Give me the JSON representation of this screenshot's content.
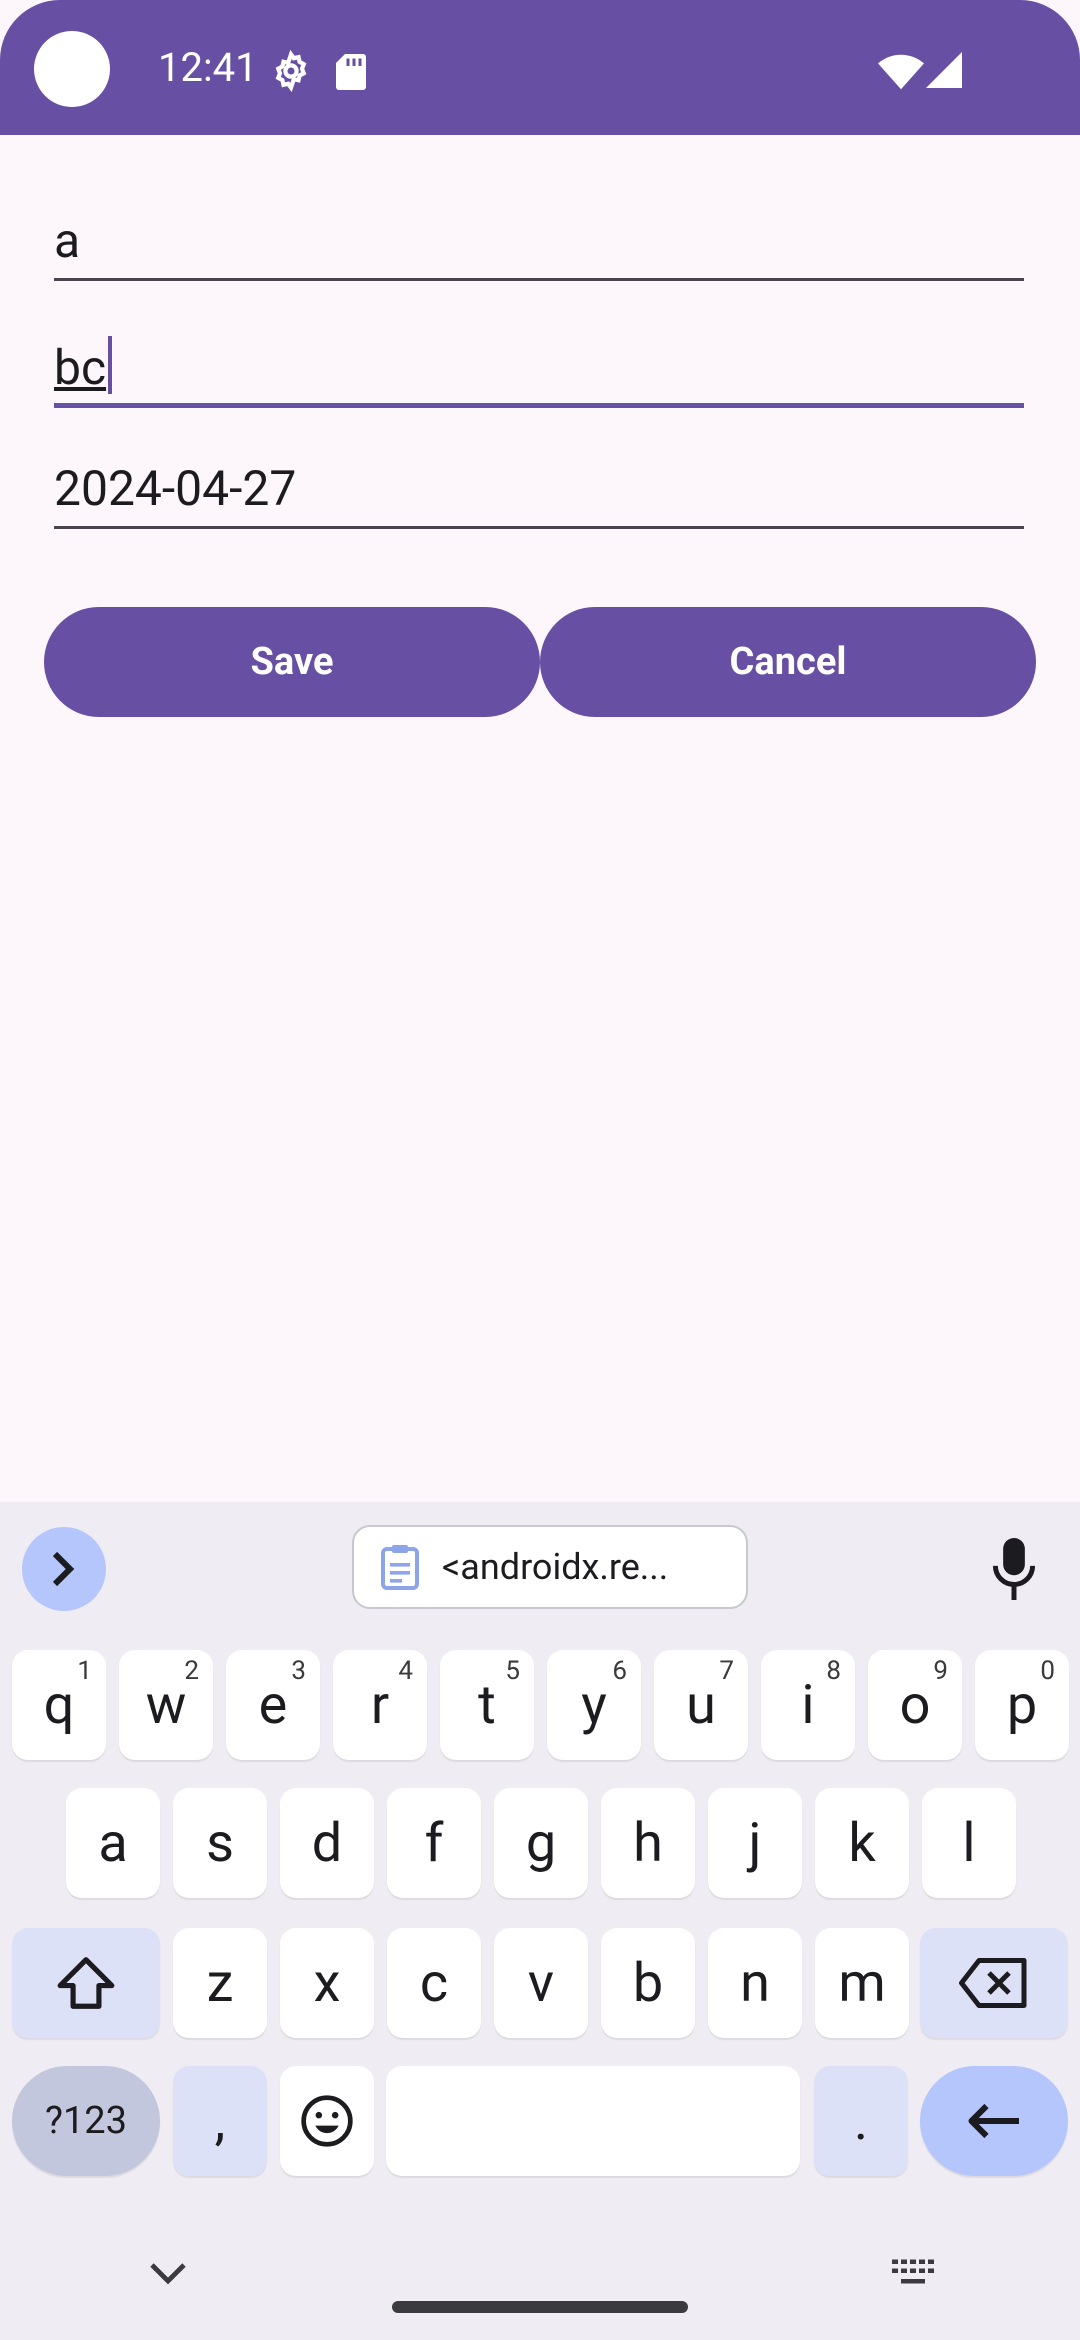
{
  "status_bar": {
    "time": "12:41"
  },
  "form": {
    "field1": {
      "value": "a"
    },
    "field2": {
      "value": "bc"
    },
    "field3": {
      "value": "2024-04-27"
    },
    "save_label": "Save",
    "cancel_label": "Cancel"
  },
  "keyboard": {
    "clipboard_text": "<androidx.re...",
    "row1": [
      {
        "label": "q",
        "sup": "1"
      },
      {
        "label": "w",
        "sup": "2"
      },
      {
        "label": "e",
        "sup": "3"
      },
      {
        "label": "r",
        "sup": "4"
      },
      {
        "label": "t",
        "sup": "5"
      },
      {
        "label": "y",
        "sup": "6"
      },
      {
        "label": "u",
        "sup": "7"
      },
      {
        "label": "i",
        "sup": "8"
      },
      {
        "label": "o",
        "sup": "9"
      },
      {
        "label": "p",
        "sup": "0"
      }
    ],
    "row2": [
      "a",
      "s",
      "d",
      "f",
      "g",
      "h",
      "j",
      "k",
      "l"
    ],
    "row3": [
      "z",
      "x",
      "c",
      "v",
      "b",
      "n",
      "m"
    ],
    "symbols_label": "?123",
    "comma_label": ",",
    "period_label": "."
  },
  "colors": {
    "primary": "#6750A4",
    "background": "#FDF7FC",
    "keyboard_bg": "#EFEDF3",
    "accent_key": "#B4C6FB"
  }
}
